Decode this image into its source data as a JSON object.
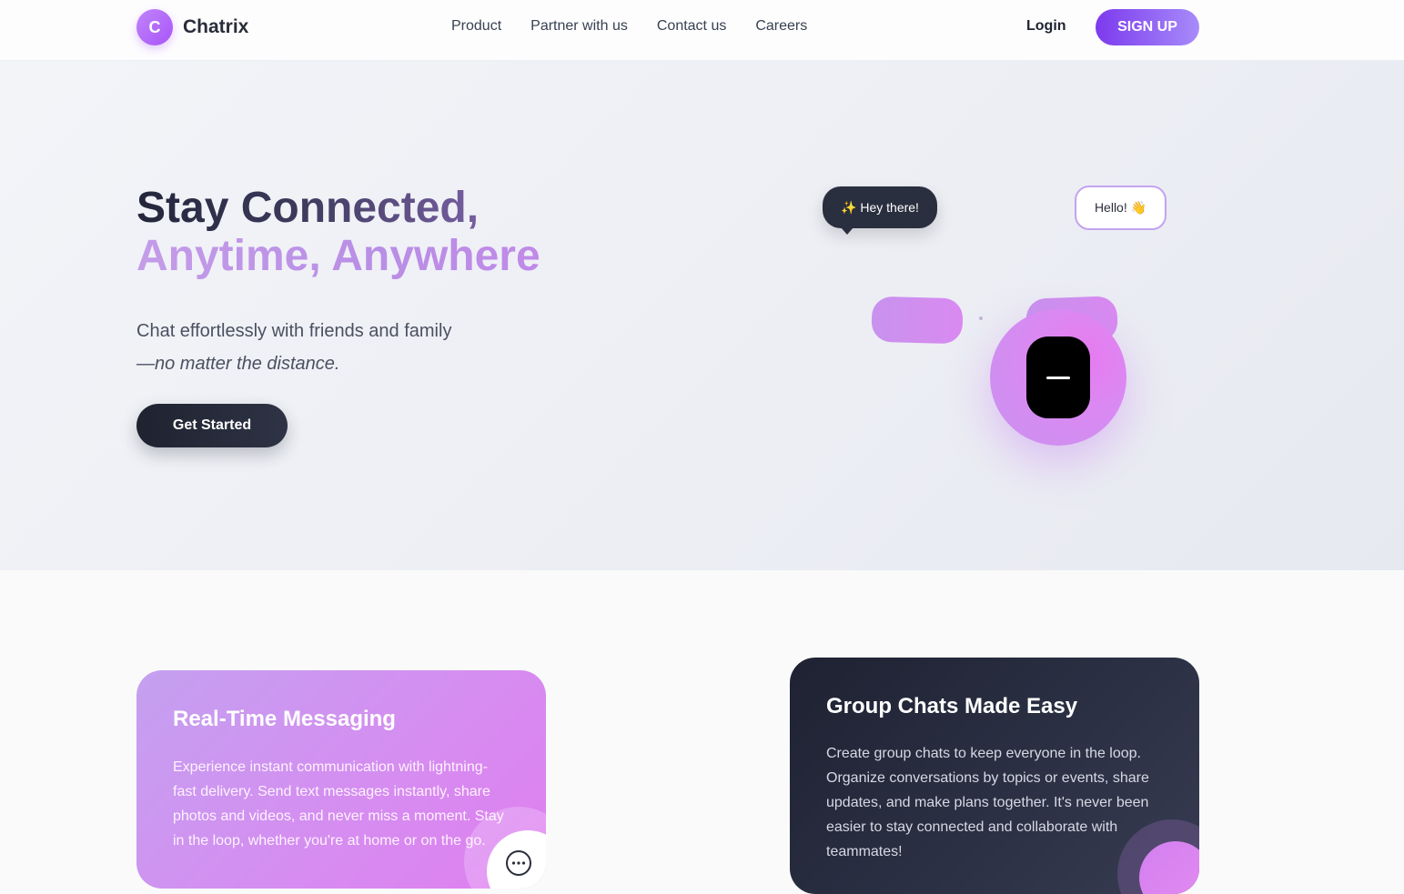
{
  "nav": {
    "logo_letter": "C",
    "brand": "Chatrix",
    "links": [
      "Product",
      "Partner with us",
      "Contact us",
      "Careers"
    ],
    "login": "Login",
    "signup": "SIGN UP"
  },
  "hero": {
    "title_line1": "Stay Connected,",
    "title_line2": "Anytime, Anywhere",
    "subtitle_line1": "Chat effortlessly with friends and family",
    "subtitle_line2": "—no matter the distance.",
    "cta": "Get Started",
    "bubble_dark": "✨ Hey there!",
    "bubble_light": "Hello! 👋"
  },
  "features": [
    {
      "title": "Real-Time Messaging",
      "text": "Experience instant communication with lightning-fast delivery. Send text messages instantly, share photos and videos, and never miss a moment. Stay in the loop, whether you're at home or on the go."
    },
    {
      "title": "Group Chats Made Easy",
      "text": "Create group chats to keep everyone in the loop. Organize conversations by topics or events, share updates, and make plans together. It's never been easier to stay connected and collaborate with teammates!"
    }
  ],
  "colors": {
    "accent": "#a855f7",
    "dark": "#1f2330",
    "gradient_pink": "#d98af0"
  }
}
